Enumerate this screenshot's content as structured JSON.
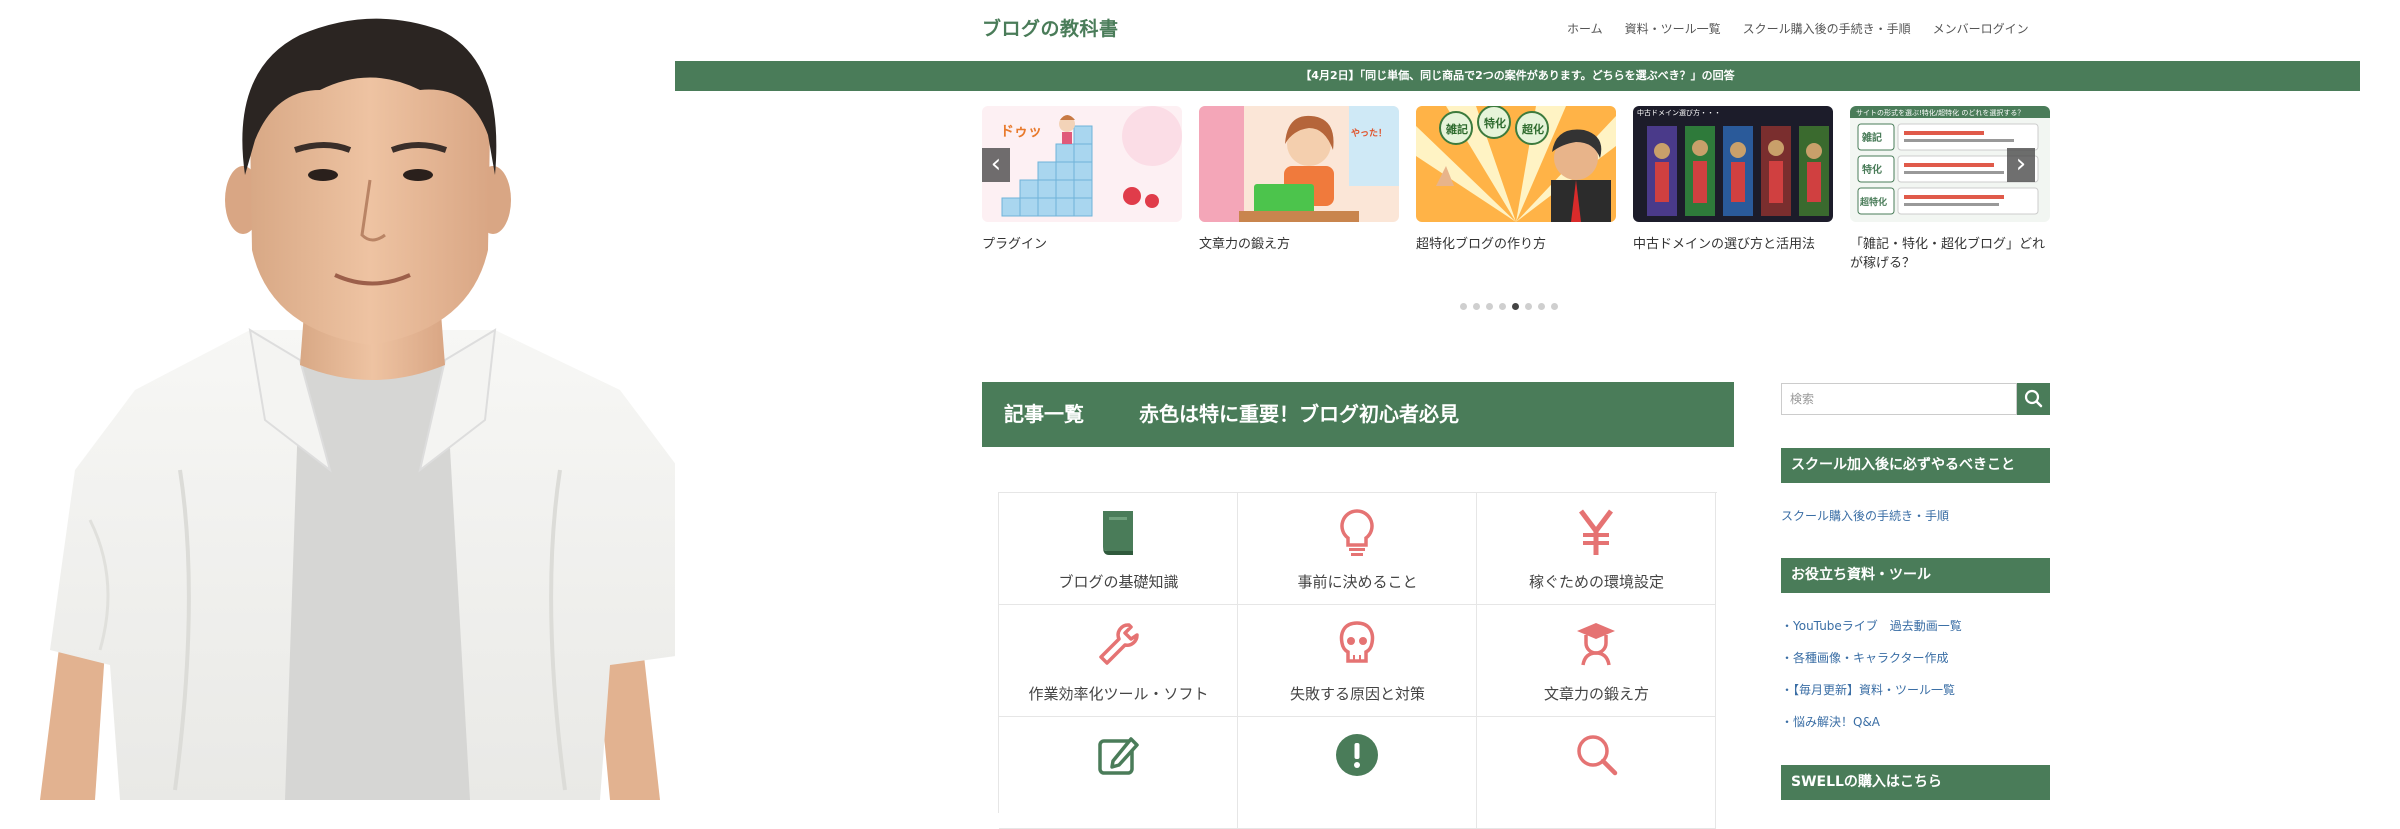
{
  "header": {
    "logo": "ブログの教科書",
    "nav": [
      "ホーム",
      "資料・ツール一覧",
      "スクール購入後の手続き・手順",
      "メンバーログイン"
    ]
  },
  "notice_bar": "【4月2日】「同じ単価、同じ商品で2つの案件があります。どちらを選ぶべき？」の回答",
  "slider": {
    "prev_icon": "chevron-left-icon",
    "next_icon": "chevron-right-icon",
    "slides": [
      {
        "caption": "プラグイン"
      },
      {
        "caption": "文章力の鍛え方"
      },
      {
        "caption": "超特化ブログの作り方"
      },
      {
        "caption": "中古ドメインの選び方と活用法"
      },
      {
        "caption": "「雑記・特化・超化ブログ」どれが稼げる？"
      }
    ],
    "dot_count": 8,
    "active_dot": 4
  },
  "thumb_text": {
    "doyu": "ドゥッ",
    "yatta": "やった！",
    "zakki": "雑記",
    "tokka": "特化",
    "chouka": "超化",
    "domain_title": "中古ドメイン選び方・・・",
    "chart_title": "サイトの形式を選ぶ!特化/超特化 のどれを選択する？",
    "row1": "雑記",
    "row2": "特化",
    "row3": "超特化"
  },
  "list_heading": {
    "left": "記事一覧",
    "right": "赤色は特に重要！ブログ初心者必見"
  },
  "categories": [
    {
      "label": "ブログの基礎知識",
      "icon": "book-icon",
      "color": "#4a7c59"
    },
    {
      "label": "事前に決めること",
      "icon": "lightbulb-icon",
      "color": "#e57373"
    },
    {
      "label": "稼ぐための環境設定",
      "icon": "yen-icon",
      "color": "#e57373"
    },
    {
      "label": "作業効率化ツール・ソフト",
      "icon": "wrench-icon",
      "color": "#e57373"
    },
    {
      "label": "失敗する原因と対策",
      "icon": "skull-icon",
      "color": "#e57373"
    },
    {
      "label": "文章力の鍛え方",
      "icon": "graduate-icon",
      "color": "#e57373"
    },
    {
      "label": "",
      "icon": "edit-icon",
      "color": "#4a7c59"
    },
    {
      "label": "",
      "icon": "exclamation-icon",
      "color": "#4a7c59"
    },
    {
      "label": "",
      "icon": "search-icon",
      "color": "#e57373"
    }
  ],
  "sidebar": {
    "search_placeholder": "検索",
    "widgets": [
      {
        "title": "スクール加入後に必ずやるべきこと",
        "links": [
          "スクール購入後の手続き・手順"
        ]
      },
      {
        "title": "お役立ち資料・ツール",
        "links": [
          "・YouTubeライブ　過去動画一覧",
          "・各種画像・キャラクター作成",
          "・【毎月更新】資料・ツール一覧",
          "・悩み解決！Q&A"
        ]
      },
      {
        "title": "SWELLの購入はこちら",
        "links": []
      }
    ]
  },
  "colors": {
    "brand_green": "#4a7c59",
    "accent_red": "#e57373",
    "link_blue": "#3a6ea5"
  }
}
